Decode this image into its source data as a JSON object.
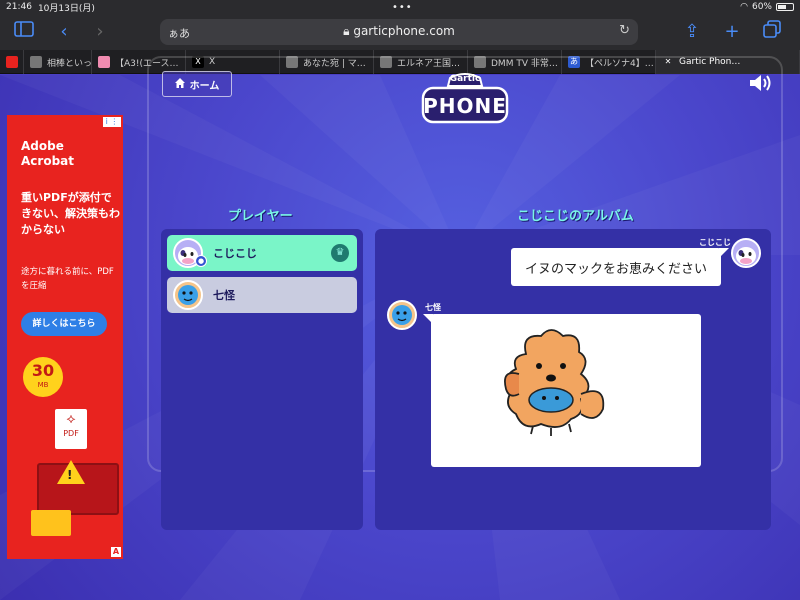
{
  "status": {
    "time": "21:46",
    "date": "10月13日(月)",
    "battery": "60%",
    "battery_fraction": 0.6
  },
  "browser": {
    "aa_label": "ぁあ",
    "url": "garticphone.com",
    "tabs": [
      {
        "label": "",
        "icon": "favicon-red"
      },
      {
        "label": "相棒といっし…",
        "icon": "favicon-page"
      },
      {
        "label": "【A3!(エース…",
        "icon": "favicon-pink"
      },
      {
        "label": "X",
        "icon": "favicon-x"
      },
      {
        "label": "あなた宛 | マ…",
        "icon": "favicon-drop"
      },
      {
        "label": "エルネア王国…",
        "icon": "favicon-g"
      },
      {
        "label": "DMM TV 非常…",
        "icon": "favicon-dmm"
      },
      {
        "label": "【ペルソナ4】…",
        "icon": "favicon-a"
      },
      {
        "label": "Gartic Phon…",
        "icon": "close-icon"
      }
    ]
  },
  "ad": {
    "brand": "Adobe Acrobat",
    "headline": "重いPDFが添付できない、解決策もわからない",
    "sub": "途方に暮れる前に、PDFを圧縮",
    "cta": "詳しくはこちら",
    "size_number": "30",
    "size_unit": "MB",
    "pdf_label": "PDF",
    "info": "i ⋮",
    "tag": "A"
  },
  "game": {
    "home_label": "ホーム",
    "logo_top": "Gartic",
    "logo_bottom": "PHONE",
    "players_title": "プレイヤー",
    "album_title": "こじこじのアルバム",
    "players": [
      {
        "name": "こじこじ",
        "color": "#7af5c8"
      },
      {
        "name": "七怪",
        "color": "#c9cce0"
      }
    ],
    "album": {
      "prompt_user": "こじこじ",
      "prompt_text": "イヌのマックをお恵みください",
      "drawing_user": "七怪"
    }
  },
  "colors": {
    "accent": "#7af5e6",
    "panel": "#3430a6",
    "page_bg": "#4b47cc"
  }
}
